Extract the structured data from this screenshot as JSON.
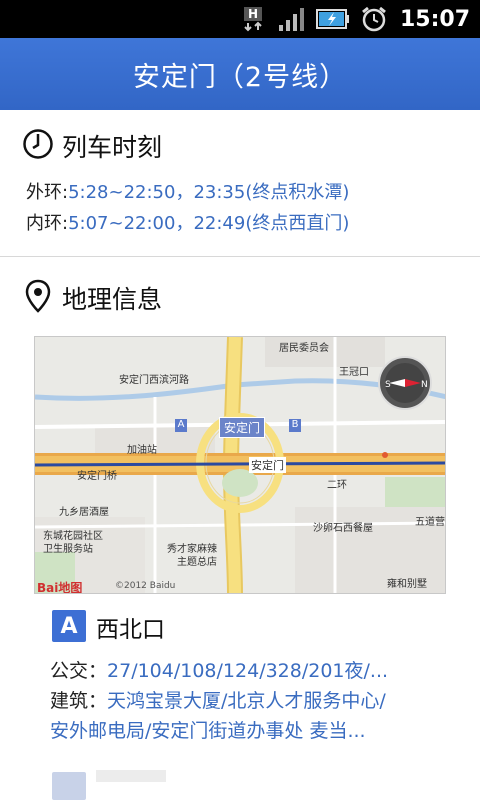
{
  "status_bar": {
    "time": "15:07",
    "icons": [
      "h-network-icon",
      "signal-icon",
      "battery-charging-icon",
      "alarm-icon"
    ]
  },
  "header": {
    "title": "安定门（2号线）"
  },
  "timetable": {
    "heading": "列车时刻",
    "icon": "clock-icon",
    "rows": [
      {
        "label": "外环:",
        "value": "5:28~22:50，23:35(终点积水潭)"
      },
      {
        "label": "内环:",
        "value": "5:07~22:00，22:49(终点西直门)"
      }
    ]
  },
  "geo": {
    "heading": "地理信息",
    "icon": "location-pin-icon",
    "map": {
      "station_label": "安定门",
      "metro_label": "安定门",
      "labels": {
        "road1": "安定门西滨河路",
        "gas": "加油站",
        "bridge": "安定门桥",
        "ring": "二环",
        "hotel": "九乡居酒屋",
        "clinic1": "东城花园社区",
        "clinic2": "卫生服务站",
        "rest1": "秀才家麻辣",
        "rest2": "主题总店",
        "shaluan": "沙卵石西餐屋",
        "wudao": "五道营",
        "wangguan": "王冠口",
        "jumin": "居民委员会",
        "yonghe": "雍和别墅",
        "exit_a": "A",
        "exit_b": "B",
        "copyright": "©2012 Baidu",
        "baidu_logo": "Bai地图"
      }
    }
  },
  "exit": {
    "badge": "A",
    "name": "西北口",
    "bus_label": "公交：",
    "bus_value": "27/104/108/124/328/201夜/...",
    "building_label": "建筑：",
    "building_value": "天鸿宝景大厦/北京人才服务中心/",
    "building_value_cont": "安外邮电局/安定门街道办事处 麦当..."
  },
  "colors": {
    "title_bar": "#3a6fd0",
    "link": "#3a6cc0",
    "badge": "#3d6fd4"
  }
}
